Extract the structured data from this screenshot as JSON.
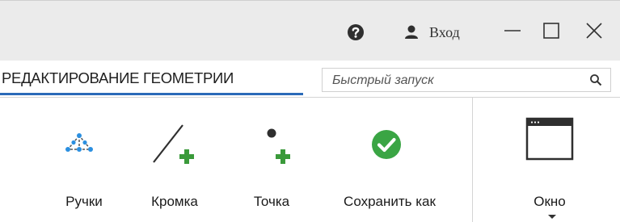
{
  "titlebar": {
    "help_icon": "question-circle-icon",
    "user_icon": "user-icon",
    "signin_label": "Вход",
    "minimize_icon": "minimize-icon",
    "maximize_icon": "maximize-icon",
    "close_icon": "close-icon"
  },
  "tabs": {
    "active_label": "РЕДАКТИРОВАНИЕ ГЕОМЕТРИИ",
    "accent_color": "#2b6ab8"
  },
  "quick_launch": {
    "placeholder": "Быстрый запуск",
    "icon": "search-icon"
  },
  "ribbon": {
    "tools": [
      {
        "label": "Ручки",
        "icon": "handles-icon"
      },
      {
        "label": "Кромка",
        "icon": "edge-add-icon"
      },
      {
        "label": "Точка",
        "icon": "point-add-icon"
      },
      {
        "label": "Сохранить как",
        "icon": "check-circle-icon"
      }
    ],
    "window_group": {
      "label": "Окно",
      "icon": "window-icon"
    },
    "colors": {
      "add_green": "#3a9a3a",
      "check_green": "#3aa544",
      "handle_blue": "#2b8fe0"
    }
  }
}
